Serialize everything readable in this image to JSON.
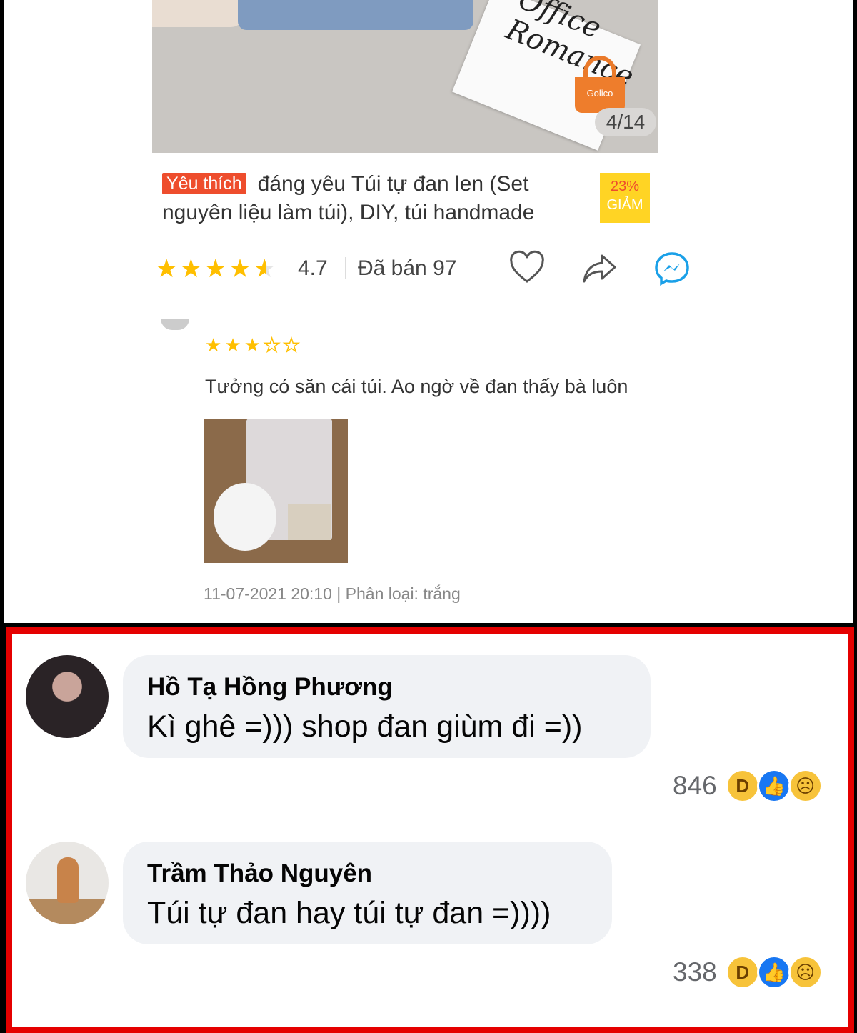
{
  "product": {
    "photo_counter": "4/14",
    "brand_logo": "Golico",
    "favorite_badge": "Yêu thích",
    "title": "đáng yêu Túi tự đan len (Set nguyên liệu làm túi), DIY, túi handmade",
    "discount_percent": "23%",
    "discount_label": "GIẢM",
    "rating": "4.7",
    "rating_stars": 4.7,
    "sold": "Đã bán 97",
    "icons": [
      "heart-icon",
      "share-icon",
      "messenger-icon"
    ]
  },
  "review": {
    "stars": 3,
    "stars_max": 5,
    "text": "Tưởng có săn cái túi. Ao ngờ về đan thấy bà luôn",
    "meta": "11-07-2021 20:10 | Phân loại: trắng"
  },
  "comments": [
    {
      "name": "Hồ Tạ Hồng Phương",
      "text": "Kì ghê =))) shop đan giùm đi =))",
      "reaction_count": "846",
      "reactions": [
        "haha",
        "like",
        "sad"
      ]
    },
    {
      "name": "Trầm Thảo Nguyên",
      "text": "Túi tự đan hay túi tự đan =))))",
      "reaction_count": "338",
      "reactions": [
        "haha",
        "like",
        "sad"
      ]
    }
  ],
  "colors": {
    "shopee_orange": "#ee4d2d",
    "star": "#ffbf00",
    "highlight_border": "#e50000",
    "fb_bubble": "#f0f2f5",
    "fb_blue": "#1877f2"
  }
}
